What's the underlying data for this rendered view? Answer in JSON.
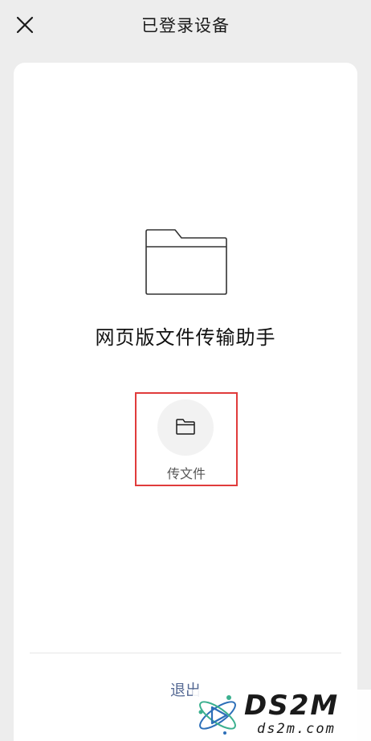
{
  "header": {
    "title": "已登录设备",
    "close_icon": "close-icon"
  },
  "main": {
    "folder_icon": "folder-icon",
    "device_name": "网页版文件传输助手",
    "send_file": {
      "icon": "folder-icon",
      "label": "传文件"
    },
    "logout_label": "退出"
  },
  "watermark": {
    "brand": "DS2M",
    "site": "ds2m.com"
  },
  "colors": {
    "background": "#ededed",
    "card": "#ffffff",
    "highlight_border": "#e03b3b",
    "logout_text": "#576b95"
  }
}
